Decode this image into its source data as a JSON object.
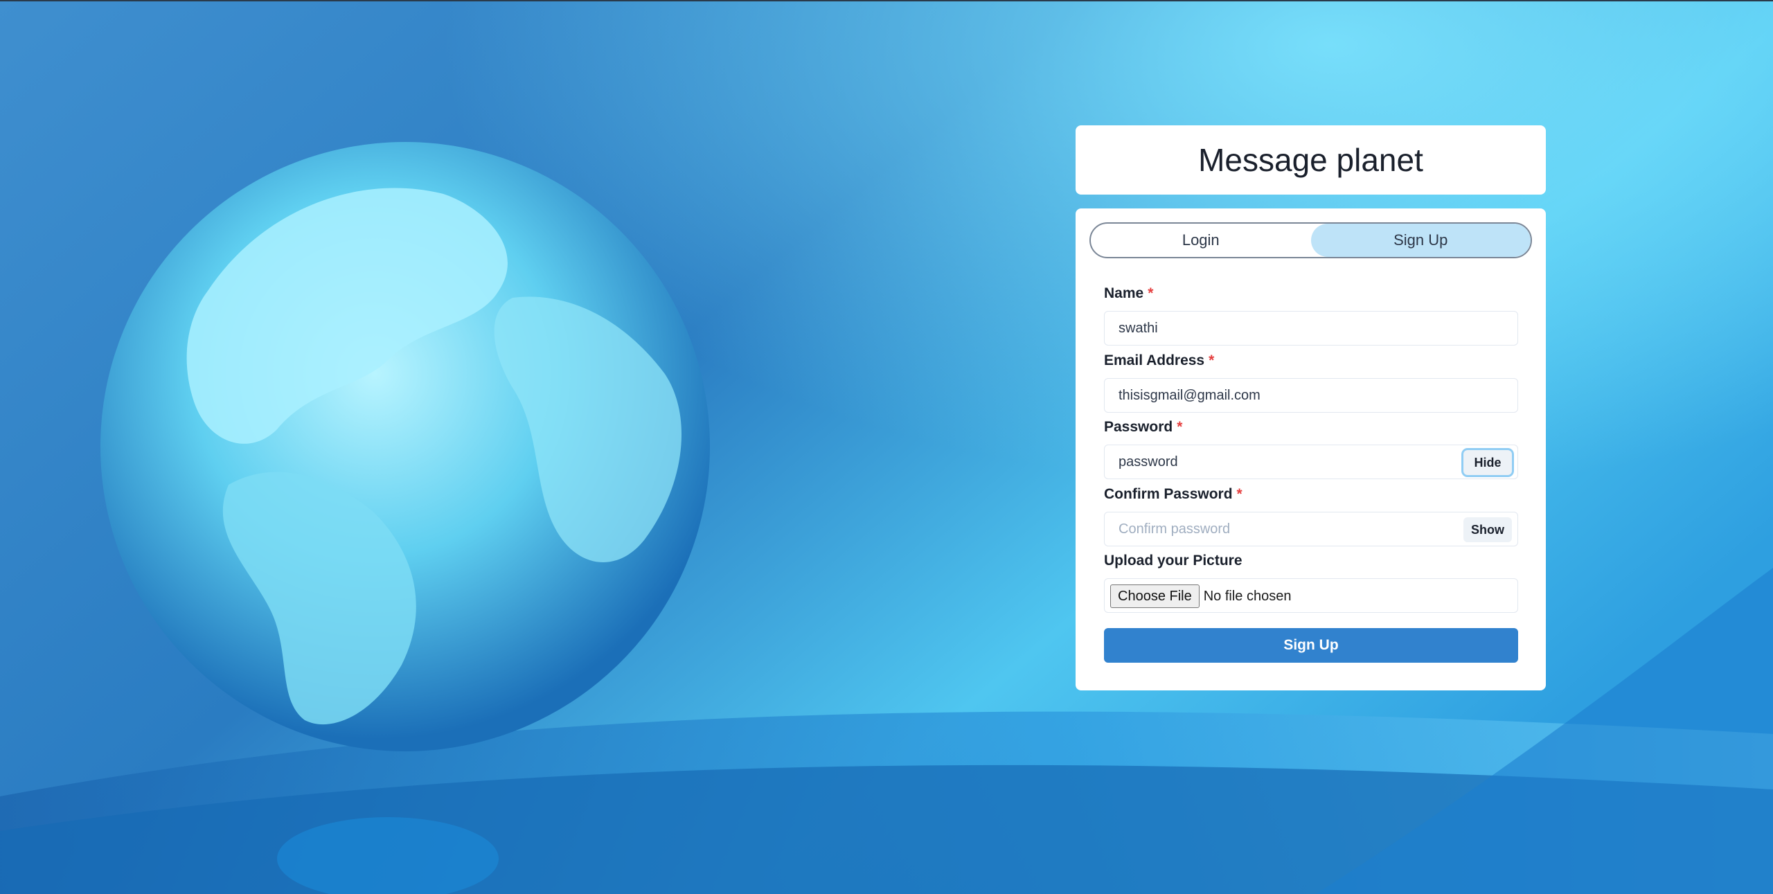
{
  "app": {
    "title": "Message planet"
  },
  "tabs": [
    {
      "label": "Login",
      "active": false
    },
    {
      "label": "Sign Up",
      "active": true
    }
  ],
  "form": {
    "required_mark": "*",
    "name": {
      "label": "Name",
      "value": "swathi",
      "placeholder": ""
    },
    "email": {
      "label": "Email Address",
      "value": "thisisgmail@gmail.com",
      "placeholder": ""
    },
    "password": {
      "label": "Password",
      "value": "password",
      "toggle_label": "Hide"
    },
    "confirm_password": {
      "label": "Confirm Password",
      "value": "",
      "placeholder": "Confirm password",
      "toggle_label": "Show"
    },
    "picture": {
      "label": "Upload your Picture",
      "button_label": "Choose File",
      "status": "No file chosen"
    },
    "submit_label": "Sign Up"
  },
  "colors": {
    "accent": "#3182ce",
    "active_tab": "#bee3f8",
    "required": "#e53e3e",
    "background": "#1f6fb5"
  },
  "icons": {
    "background": "globe-image"
  }
}
